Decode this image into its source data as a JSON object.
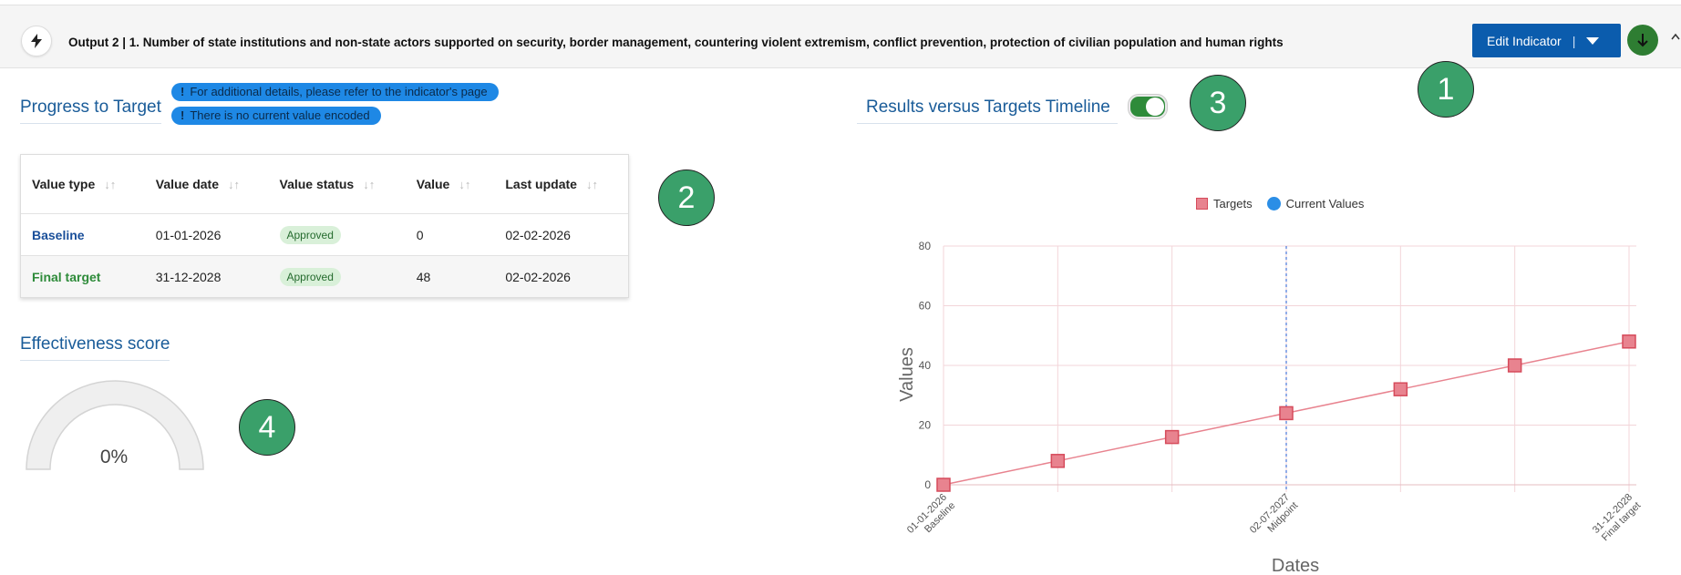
{
  "header": {
    "title": "Output 2 | 1. Number of state institutions and non-state actors supported on security, border management, countering violent extremism, conflict prevention, protection of civilian population and human rights",
    "edit_label": "Edit Indicator",
    "edit_separator": "|"
  },
  "callouts": [
    "1",
    "2",
    "3",
    "4"
  ],
  "progress": {
    "title": "Progress to Target",
    "notes": [
      "For additional details, please refer to the indicator's page",
      "There is no current value encoded"
    ],
    "note_mark": "!"
  },
  "table": {
    "sort_glyph": "↓↑",
    "columns": [
      "Value type",
      "Value date",
      "Value status",
      "Value",
      "Last update"
    ],
    "rows": [
      {
        "type": "Baseline",
        "date": "01-01-2026",
        "status": "Approved",
        "value": "0",
        "updated": "02-02-2026"
      },
      {
        "type": "Final target",
        "date": "31-12-2028",
        "status": "Approved",
        "value": "48",
        "updated": "02-02-2026"
      }
    ]
  },
  "effectiveness": {
    "title": "Effectiveness score",
    "value_label": "0%",
    "value": 0
  },
  "timeline": {
    "title": "Results versus Targets Timeline",
    "toggle_on": true
  },
  "chart_data": {
    "type": "line",
    "legend": [
      "Targets",
      "Current Values"
    ],
    "legend_position": "top",
    "xlabel": "Dates",
    "ylabel": "Values",
    "ylim": [
      0,
      80
    ],
    "yticks": [
      0,
      20,
      40,
      60,
      80
    ],
    "x_tick_labels": [
      {
        "date": "01-01-2026",
        "label": "Baseline"
      },
      {
        "date": "02-07-2027",
        "label": "Midpoint"
      },
      {
        "date": "31-12-2028",
        "label": "Final target"
      }
    ],
    "midpoint_date": "02-07-2027",
    "series": [
      {
        "name": "Targets",
        "color": "#e8838f",
        "values": [
          0,
          8,
          16,
          24,
          32,
          40,
          48
        ]
      },
      {
        "name": "Current Values",
        "color": "#2b8ee6",
        "values": []
      }
    ],
    "grid": true
  }
}
